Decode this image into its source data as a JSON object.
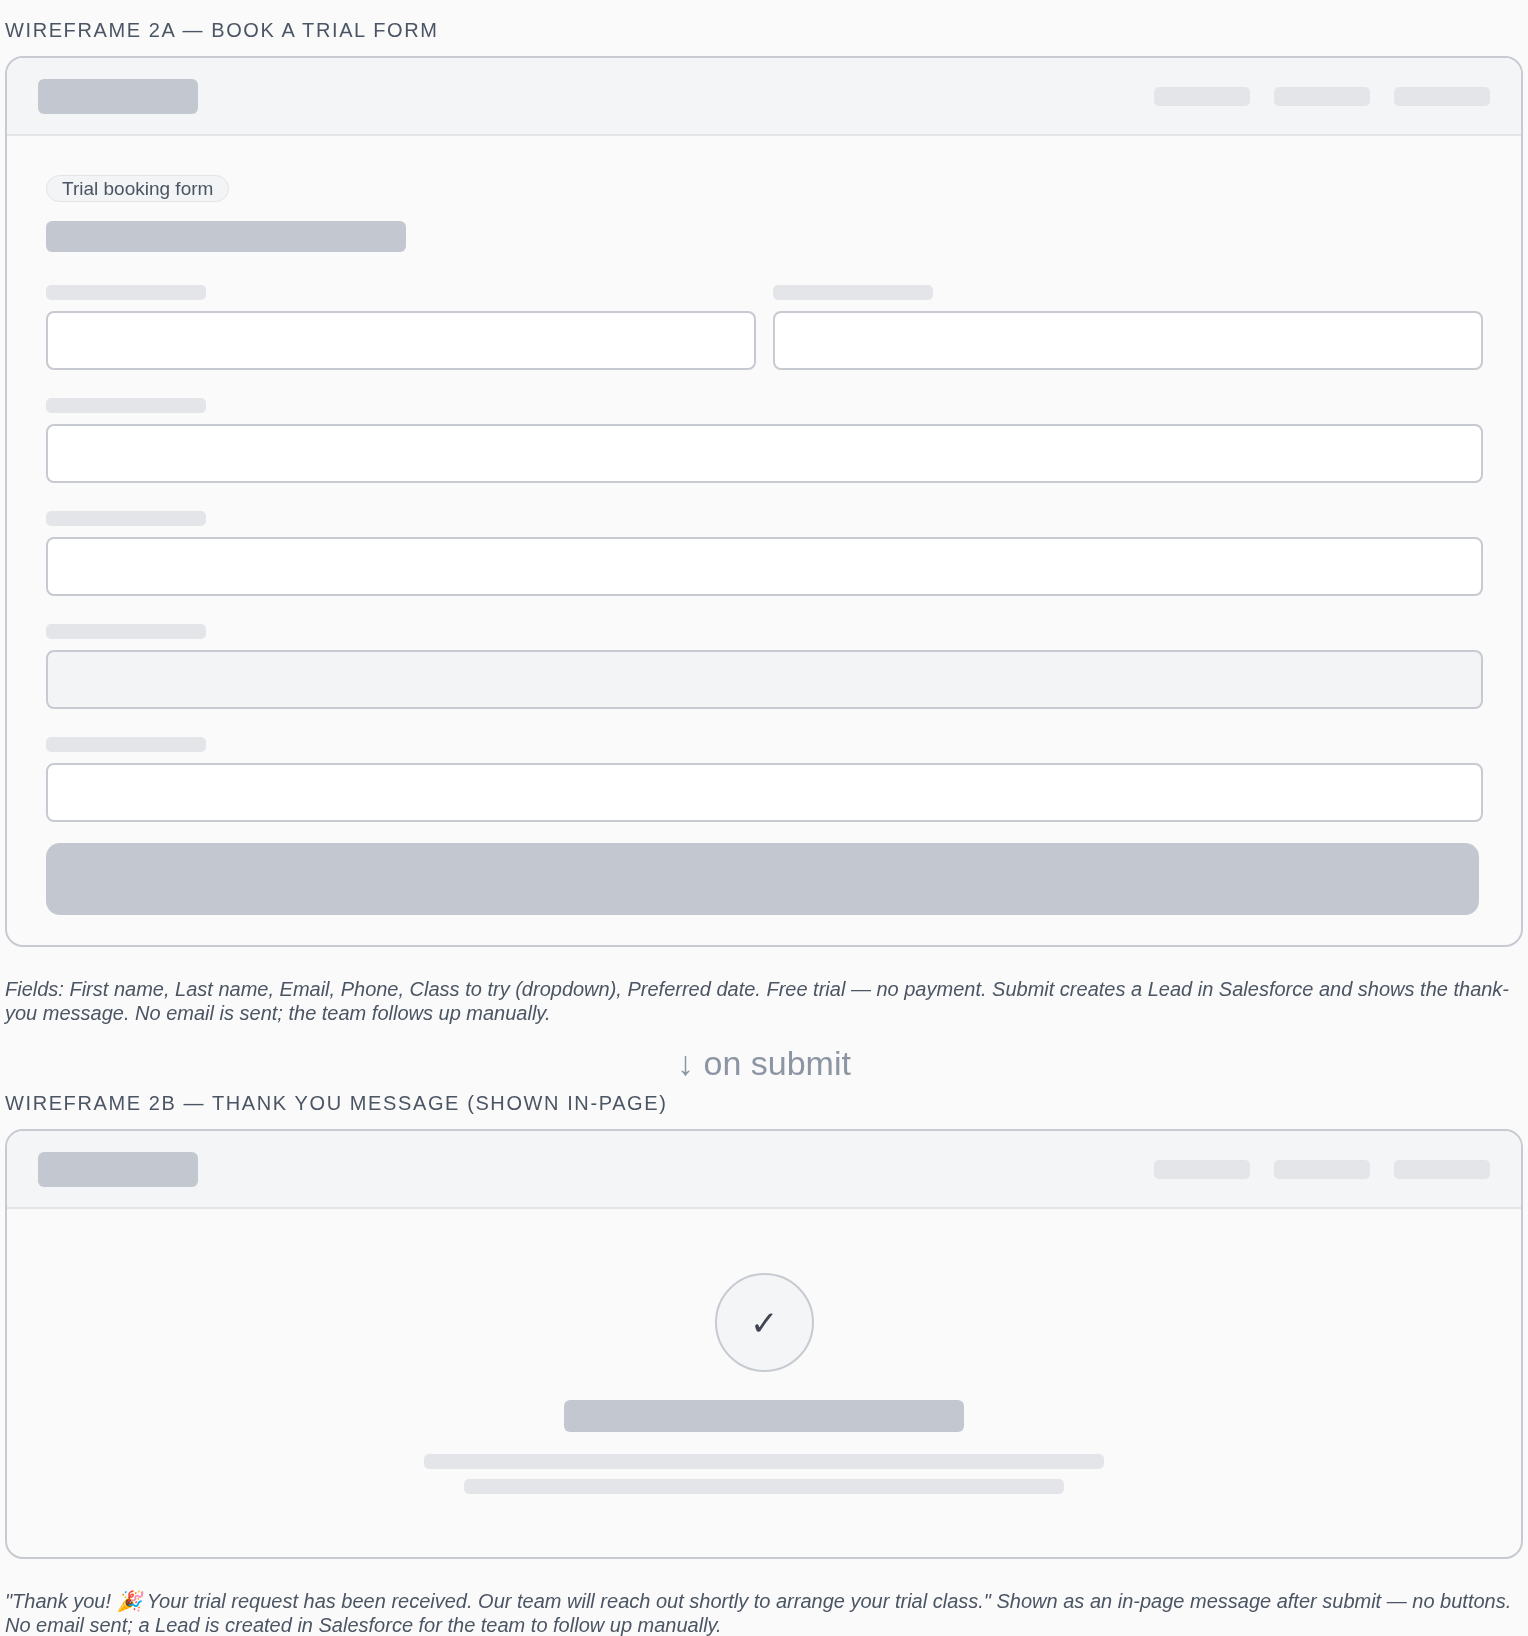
{
  "wireframes": [
    {
      "kind": "form",
      "title": "WIREFRAME 2A — BOOK A TRIAL FORM",
      "badge": "Trial booking form",
      "field_rows": [
        [
          {
            "kind": "text"
          },
          {
            "kind": "text"
          }
        ],
        [
          {
            "kind": "text"
          }
        ],
        [
          {
            "kind": "text"
          }
        ],
        [
          {
            "kind": "dropdown"
          }
        ],
        [
          {
            "kind": "text"
          }
        ]
      ],
      "caption": "Fields: First name, Last name, Email, Phone, Class to try (dropdown), Preferred date. Free trial — no payment. Submit creates a Lead in Salesforce and shows the thank-you message. No email is sent; the team follows up manually."
    },
    {
      "kind": "arrow",
      "text": "↓ on submit"
    },
    {
      "kind": "confirmation",
      "title": "WIREFRAME 2B — THANK YOU MESSAGE (SHOWN IN-PAGE)",
      "check_glyph": "✓",
      "caption": "\"Thank you! 🎉 Your trial request has been received. Our team will reach out shortly to arrange your trial class.\" Shown as an in-page message after submit — no buttons. No email sent; a Lead is created in Salesforce for the team to follow up manually."
    }
  ]
}
